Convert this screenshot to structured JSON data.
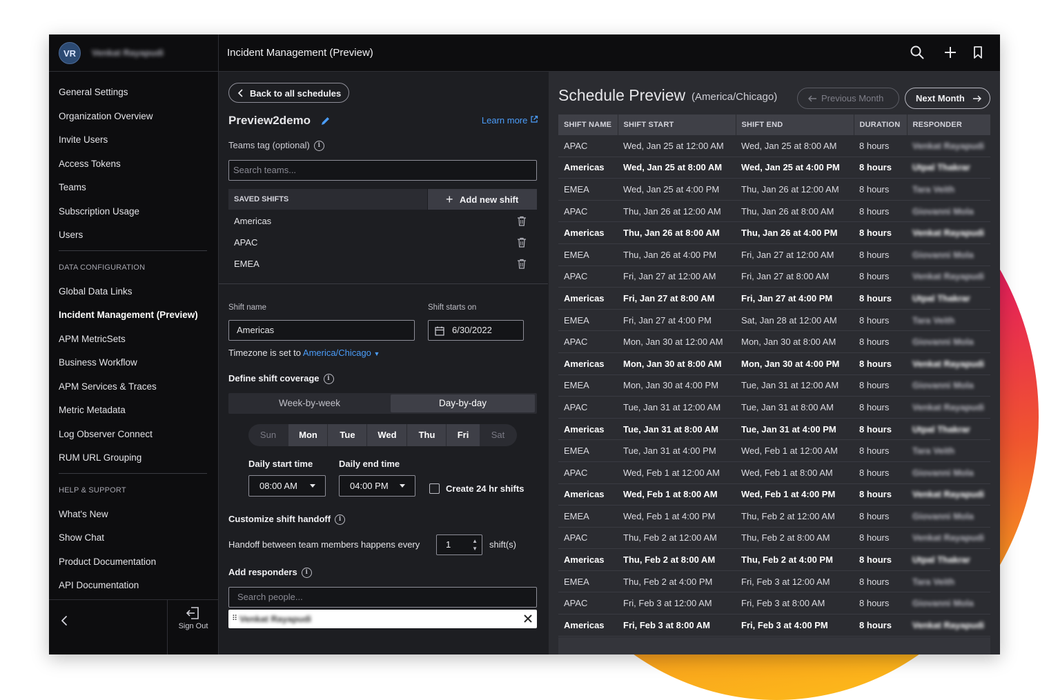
{
  "header": {
    "avatar_initials": "VR",
    "username": "Venkat Rayapudi",
    "app_title": "Incident Management (Preview)",
    "icons": [
      "search-icon",
      "plus-icon",
      "bookmark-icon"
    ]
  },
  "sidebar": {
    "items_top": [
      {
        "label": "General Settings"
      },
      {
        "label": "Organization Overview"
      },
      {
        "label": "Invite Users"
      },
      {
        "label": "Access Tokens"
      },
      {
        "label": "Teams"
      },
      {
        "label": "Subscription Usage"
      },
      {
        "label": "Users"
      }
    ],
    "data_section_title": "DATA CONFIGURATION",
    "items_data": [
      {
        "label": "Global Data Links"
      },
      {
        "label": "Incident Management (Preview)",
        "active": true
      },
      {
        "label": "APM MetricSets"
      },
      {
        "label": "Business Workflow"
      },
      {
        "label": "APM Services & Traces"
      },
      {
        "label": "Metric Metadata"
      },
      {
        "label": "Log Observer Connect"
      },
      {
        "label": "RUM URL Grouping"
      }
    ],
    "help_section_title": "HELP & SUPPORT",
    "items_help": [
      {
        "label": "What's New"
      },
      {
        "label": "Show Chat"
      },
      {
        "label": "Product Documentation"
      },
      {
        "label": "API Documentation"
      }
    ],
    "sign_out_label": "Sign Out"
  },
  "editor": {
    "back_label": "Back to all schedules",
    "schedule_name": "Preview2demo",
    "learn_more": "Learn more",
    "teams_tag_label": "Teams tag (optional)",
    "teams_placeholder": "Search teams...",
    "saved_shifts_title": "SAVED SHIFTS",
    "add_shift_label": "Add new shift",
    "saved_shifts": [
      "Americas",
      "APAC",
      "EMEA"
    ],
    "shift_name_label": "Shift name",
    "shift_name_value": "Americas",
    "shift_starts_label": "Shift starts on",
    "shift_starts_value": "6/30/2022",
    "timezone_prefix": "Timezone is set to",
    "timezone_value": "America/Chicago",
    "coverage_title": "Define shift coverage",
    "coverage_options": [
      "Week-by-week",
      "Day-by-day"
    ],
    "coverage_selected": "Day-by-day",
    "days": [
      {
        "label": "Sun",
        "on": false
      },
      {
        "label": "Mon",
        "on": true
      },
      {
        "label": "Tue",
        "on": true
      },
      {
        "label": "Wed",
        "on": true
      },
      {
        "label": "Thu",
        "on": true
      },
      {
        "label": "Fri",
        "on": true
      },
      {
        "label": "Sat",
        "on": false
      }
    ],
    "daily_start_label": "Daily start time",
    "daily_start_value": "08:00 AM",
    "daily_end_label": "Daily end time",
    "daily_end_value": "04:00 PM",
    "create_24hr_label": "Create 24 hr shifts",
    "create_24hr_checked": false,
    "handoff_title": "Customize shift handoff",
    "handoff_text": "Handoff between team members happens every",
    "handoff_value": "1",
    "handoff_unit": "shift(s)",
    "responders_title": "Add responders",
    "people_placeholder": "Search people...",
    "responder_chip": "Venkat Rayapudi"
  },
  "preview": {
    "title": "Schedule Preview",
    "timezone": "(America/Chicago)",
    "prev_month": "Previous Month",
    "next_month": "Next Month",
    "columns": [
      "SHIFT NAME",
      "SHIFT START",
      "SHIFT END",
      "DURATION",
      "RESPONDER"
    ],
    "rows": [
      [
        "APAC",
        "Wed, Jan 25 at 12:00 AM",
        "Wed, Jan 25 at 8:00 AM",
        "8 hours",
        "Venkat Rayapudi"
      ],
      [
        "Americas",
        "Wed, Jan 25 at 8:00 AM",
        "Wed, Jan 25 at 4:00 PM",
        "8 hours",
        "Utpal Thakrar"
      ],
      [
        "EMEA",
        "Wed, Jan 25 at 4:00 PM",
        "Thu, Jan 26 at 12:00 AM",
        "8 hours",
        "Tara Veith"
      ],
      [
        "APAC",
        "Thu, Jan 26 at 12:00 AM",
        "Thu, Jan 26 at 8:00 AM",
        "8 hours",
        "Giovanni Mola"
      ],
      [
        "Americas",
        "Thu, Jan 26 at 8:00 AM",
        "Thu, Jan 26 at 4:00 PM",
        "8 hours",
        "Venkat Rayapudi"
      ],
      [
        "EMEA",
        "Thu, Jan 26 at 4:00 PM",
        "Fri, Jan 27 at 12:00 AM",
        "8 hours",
        "Giovanni Mola"
      ],
      [
        "APAC",
        "Fri, Jan 27 at 12:00 AM",
        "Fri, Jan 27 at 8:00 AM",
        "8 hours",
        "Venkat Rayapudi"
      ],
      [
        "Americas",
        "Fri, Jan 27 at 8:00 AM",
        "Fri, Jan 27 at 4:00 PM",
        "8 hours",
        "Utpal Thakrar"
      ],
      [
        "EMEA",
        "Fri, Jan 27 at 4:00 PM",
        "Sat, Jan 28 at 12:00 AM",
        "8 hours",
        "Tara Veith"
      ],
      [
        "APAC",
        "Mon, Jan 30 at 12:00 AM",
        "Mon, Jan 30 at 8:00 AM",
        "8 hours",
        "Giovanni Mola"
      ],
      [
        "Americas",
        "Mon, Jan 30 at 8:00 AM",
        "Mon, Jan 30 at 4:00 PM",
        "8 hours",
        "Venkat Rayapudi"
      ],
      [
        "EMEA",
        "Mon, Jan 30 at 4:00 PM",
        "Tue, Jan 31 at 12:00 AM",
        "8 hours",
        "Giovanni Mola"
      ],
      [
        "APAC",
        "Tue, Jan 31 at 12:00 AM",
        "Tue, Jan 31 at 8:00 AM",
        "8 hours",
        "Venkat Rayapudi"
      ],
      [
        "Americas",
        "Tue, Jan 31 at 8:00 AM",
        "Tue, Jan 31 at 4:00 PM",
        "8 hours",
        "Utpal Thakrar"
      ],
      [
        "EMEA",
        "Tue, Jan 31 at 4:00 PM",
        "Wed, Feb 1 at 12:00 AM",
        "8 hours",
        "Tara Veith"
      ],
      [
        "APAC",
        "Wed, Feb 1 at 12:00 AM",
        "Wed, Feb 1 at 8:00 AM",
        "8 hours",
        "Giovanni Mola"
      ],
      [
        "Americas",
        "Wed, Feb 1 at 8:00 AM",
        "Wed, Feb 1 at 4:00 PM",
        "8 hours",
        "Venkat Rayapudi"
      ],
      [
        "EMEA",
        "Wed, Feb 1 at 4:00 PM",
        "Thu, Feb 2 at 12:00 AM",
        "8 hours",
        "Giovanni Mola"
      ],
      [
        "APAC",
        "Thu, Feb 2 at 12:00 AM",
        "Thu, Feb 2 at 8:00 AM",
        "8 hours",
        "Venkat Rayapudi"
      ],
      [
        "Americas",
        "Thu, Feb 2 at 8:00 AM",
        "Thu, Feb 2 at 4:00 PM",
        "8 hours",
        "Utpal Thakrar"
      ],
      [
        "EMEA",
        "Thu, Feb 2 at 4:00 PM",
        "Fri, Feb 3 at 12:00 AM",
        "8 hours",
        "Tara Veith"
      ],
      [
        "APAC",
        "Fri, Feb 3 at 12:00 AM",
        "Fri, Feb 3 at 8:00 AM",
        "8 hours",
        "Giovanni Mola"
      ],
      [
        "Americas",
        "Fri, Feb 3 at 8:00 AM",
        "Fri, Feb 3 at 4:00 PM",
        "8 hours",
        "Venkat Rayapudi"
      ]
    ]
  },
  "colors": {
    "accent_link": "#4b9dfa",
    "panel_dark": "#0d0d0f",
    "panel_mid": "#1d1e22",
    "panel_preview": "#2b2c31"
  }
}
